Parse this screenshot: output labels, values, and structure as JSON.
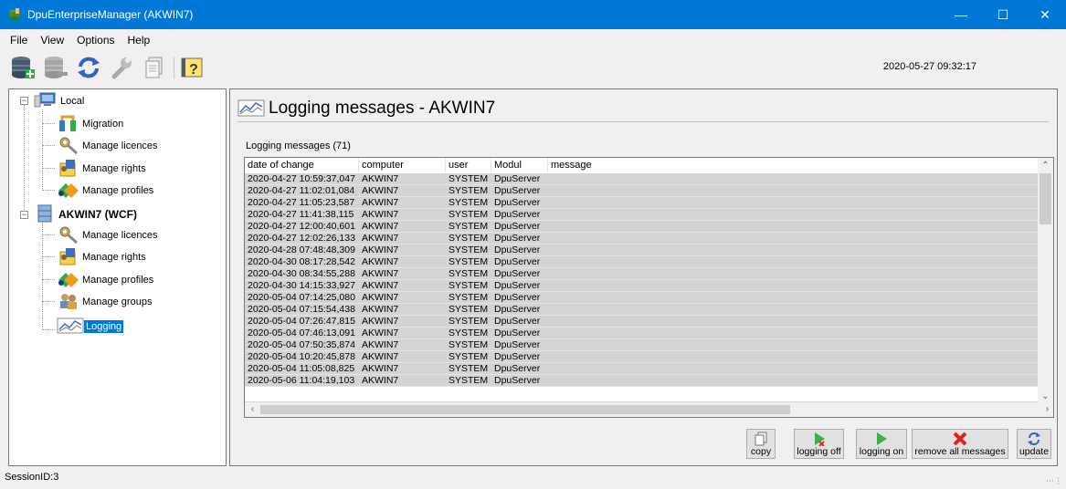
{
  "window": {
    "title": "DpuEnterpriseManager (AKWIN7)",
    "minimize_icon": "minimize-icon",
    "maximize_icon": "maximize-icon",
    "close_icon": "close-icon"
  },
  "menu": [
    "File",
    "View",
    "Options",
    "Help"
  ],
  "toolbar": {
    "icons": [
      "database-green-icon",
      "database-gray-icon",
      "refresh-icon",
      "wrench-icon",
      "document-icon",
      "help-icon"
    ],
    "datetime": "2020-05-27 09:32:17"
  },
  "tree": {
    "local": {
      "label": "Local",
      "children": [
        "Migration",
        "Manage licences",
        "Manage rights",
        "Manage profiles"
      ]
    },
    "server": {
      "label": "AKWIN7 (WCF)",
      "children": [
        "Manage licences",
        "Manage rights",
        "Manage profiles",
        "Manage groups",
        "Logging"
      ]
    }
  },
  "panel": {
    "title": "Logging messages - AKWIN7",
    "count_label": "Logging messages (71)"
  },
  "grid": {
    "columns": [
      "date of change",
      "computer",
      "user",
      "Modul",
      "message"
    ],
    "rows": [
      [
        "2020-04-27 10:59:37,047",
        "AKWIN7",
        "SYSTEM",
        "DpuServer",
        ""
      ],
      [
        "2020-04-27 11:02:01,084",
        "AKWIN7",
        "SYSTEM",
        "DpuServer",
        ""
      ],
      [
        "2020-04-27 11:05:23,587",
        "AKWIN7",
        "SYSTEM",
        "DpuServer",
        ""
      ],
      [
        "2020-04-27 11:41:38,115",
        "AKWIN7",
        "SYSTEM",
        "DpuServer",
        ""
      ],
      [
        "2020-04-27 12:00:40,601",
        "AKWIN7",
        "SYSTEM",
        "DpuServer",
        ""
      ],
      [
        "2020-04-27 12:02:26,133",
        "AKWIN7",
        "SYSTEM",
        "DpuServer",
        ""
      ],
      [
        "2020-04-28 07:48:48,309",
        "AKWIN7",
        "SYSTEM",
        "DpuServer",
        ""
      ],
      [
        "2020-04-30 08:17:28,542",
        "AKWIN7",
        "SYSTEM",
        "DpuServer",
        ""
      ],
      [
        "2020-04-30 08:34:55,288",
        "AKWIN7",
        "SYSTEM",
        "DpuServer",
        ""
      ],
      [
        "2020-04-30 14:15:33,927",
        "AKWIN7",
        "SYSTEM",
        "DpuServer",
        ""
      ],
      [
        "2020-05-04 07:14:25,080",
        "AKWIN7",
        "SYSTEM",
        "DpuServer",
        ""
      ],
      [
        "2020-05-04 07:15:54,438",
        "AKWIN7",
        "SYSTEM",
        "DpuServer",
        ""
      ],
      [
        "2020-05-04 07:26:47,815",
        "AKWIN7",
        "SYSTEM",
        "DpuServer",
        ""
      ],
      [
        "2020-05-04 07:46:13,091",
        "AKWIN7",
        "SYSTEM",
        "DpuServer",
        ""
      ],
      [
        "2020-05-04 07:50:35,874",
        "AKWIN7",
        "SYSTEM",
        "DpuServer",
        ""
      ],
      [
        "2020-05-04 10:20:45,878",
        "AKWIN7",
        "SYSTEM",
        "DpuServer",
        ""
      ],
      [
        "2020-05-04 11:05:08,825",
        "AKWIN7",
        "SYSTEM",
        "DpuServer",
        ""
      ],
      [
        "2020-05-06 11:04:19,103",
        "AKWIN7",
        "SYSTEM",
        "DpuServer",
        ""
      ]
    ]
  },
  "buttons": {
    "copy": "copy",
    "logging_off": "logging off",
    "logging_on": "logging on",
    "remove_all": "remove all messages",
    "update": "update"
  },
  "status": {
    "session": "SessionID:3"
  },
  "colors": {
    "titlebar": "#0078d7",
    "selection": "#0078d7",
    "row_background": "#d4d4d4"
  }
}
